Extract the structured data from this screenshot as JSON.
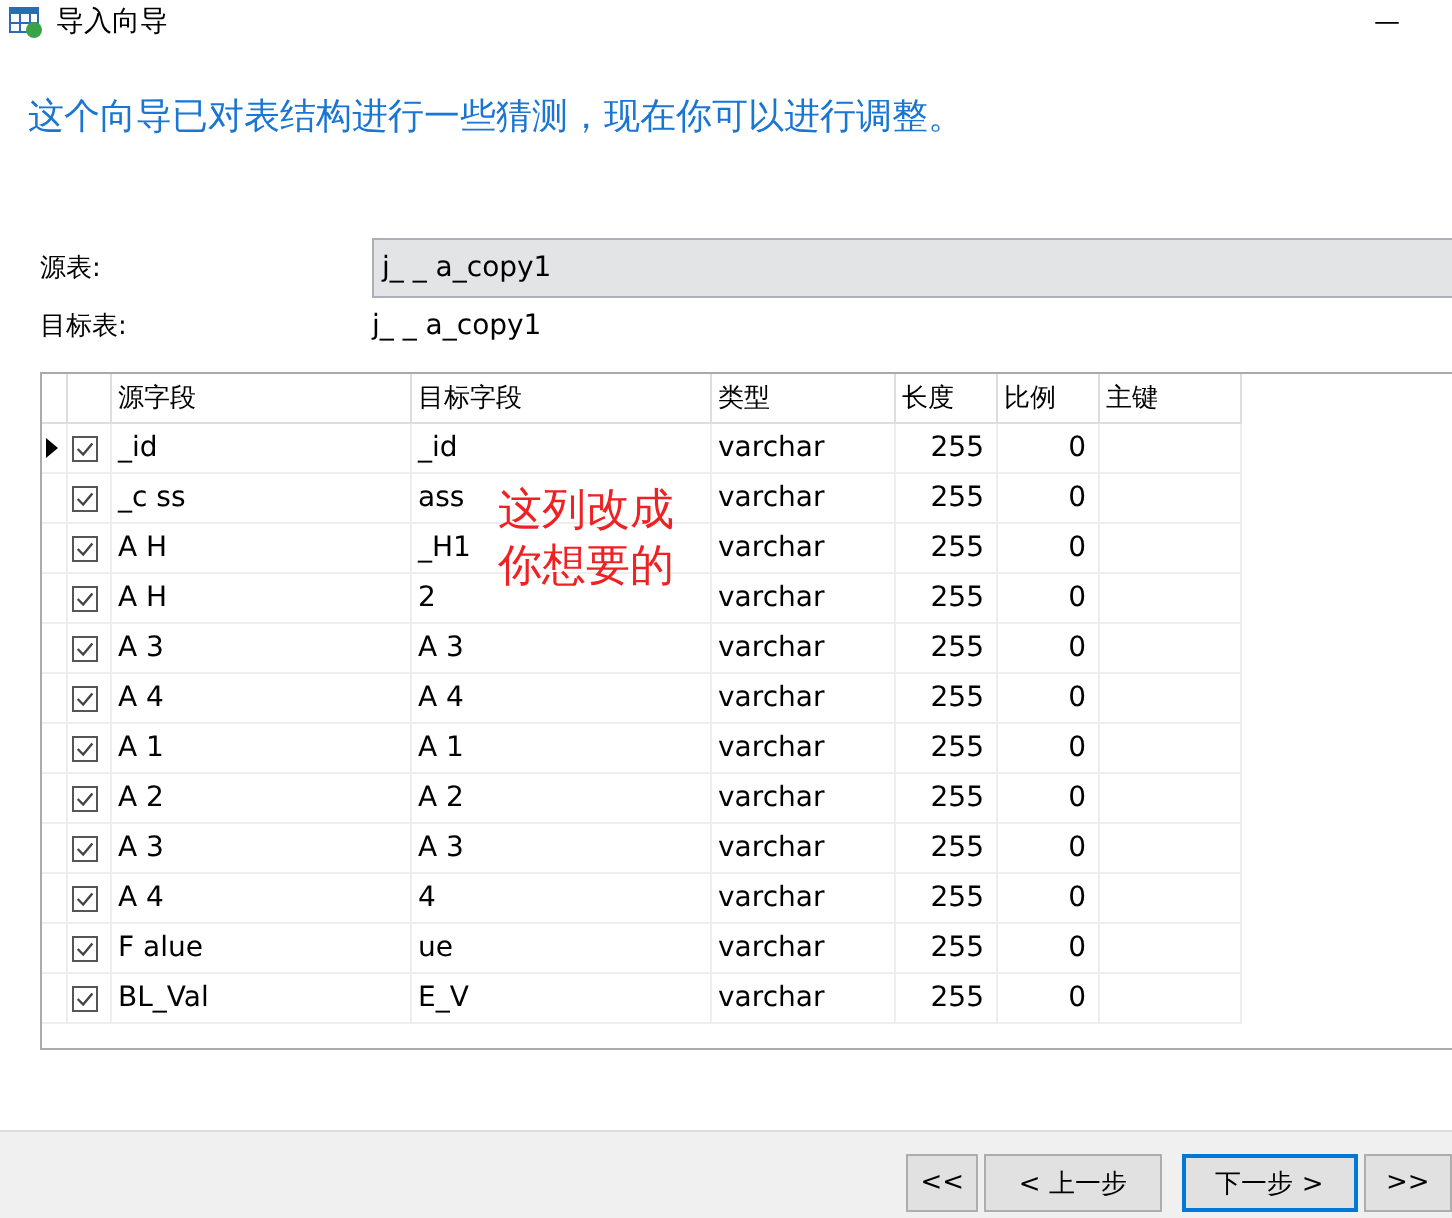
{
  "window": {
    "title": "导入向导",
    "minimize": "—"
  },
  "heading": "这个向导已对表结构进行一些猜测，现在你可以进行调整。",
  "source_table": {
    "label": "源表:",
    "value": "j_ _ a_copy1"
  },
  "target_table": {
    "label": "目标表:",
    "value": "j_ _ a_copy1"
  },
  "table": {
    "columns": [
      "源字段",
      "目标字段",
      "类型",
      "长度",
      "比例",
      "主键"
    ],
    "rows": [
      {
        "current": true,
        "checked": true,
        "source": "_id",
        "target": "_id",
        "type": "varchar",
        "length": "255",
        "scale": "0"
      },
      {
        "current": false,
        "checked": true,
        "source": "_c ss",
        "target": "ass",
        "type": "varchar",
        "length": "255",
        "scale": "0"
      },
      {
        "current": false,
        "checked": true,
        "source": "A H",
        "target": "_H1",
        "type": "varchar",
        "length": "255",
        "scale": "0"
      },
      {
        "current": false,
        "checked": true,
        "source": "A H",
        "target": "2",
        "type": "varchar",
        "length": "255",
        "scale": "0"
      },
      {
        "current": false,
        "checked": true,
        "source": "A 3",
        "target": "A 3",
        "type": "varchar",
        "length": "255",
        "scale": "0"
      },
      {
        "current": false,
        "checked": true,
        "source": "A 4",
        "target": "A 4",
        "type": "varchar",
        "length": "255",
        "scale": "0"
      },
      {
        "current": false,
        "checked": true,
        "source": "A 1",
        "target": "A 1",
        "type": "varchar",
        "length": "255",
        "scale": "0"
      },
      {
        "current": false,
        "checked": true,
        "source": "A 2",
        "target": "A 2",
        "type": "varchar",
        "length": "255",
        "scale": "0"
      },
      {
        "current": false,
        "checked": true,
        "source": "A 3",
        "target": "A 3",
        "type": "varchar",
        "length": "255",
        "scale": "0"
      },
      {
        "current": false,
        "checked": true,
        "source": "A 4",
        "target": "4",
        "type": "varchar",
        "length": "255",
        "scale": "0"
      },
      {
        "current": false,
        "checked": true,
        "source": "F alue",
        "target": "ue",
        "type": "varchar",
        "length": "255",
        "scale": "0"
      },
      {
        "current": false,
        "checked": true,
        "source": "BL_Val",
        "target": "E_V",
        "type": "varchar",
        "length": "255",
        "scale": "0"
      }
    ]
  },
  "annotation": [
    "这列改成",
    "你想要的"
  ],
  "buttons": [
    {
      "label": "<<",
      "focused": false
    },
    {
      "label": "< 上一步",
      "focused": false
    },
    {
      "label": "下一步 >",
      "focused": true
    },
    {
      "label": ">>",
      "focused": false
    }
  ]
}
